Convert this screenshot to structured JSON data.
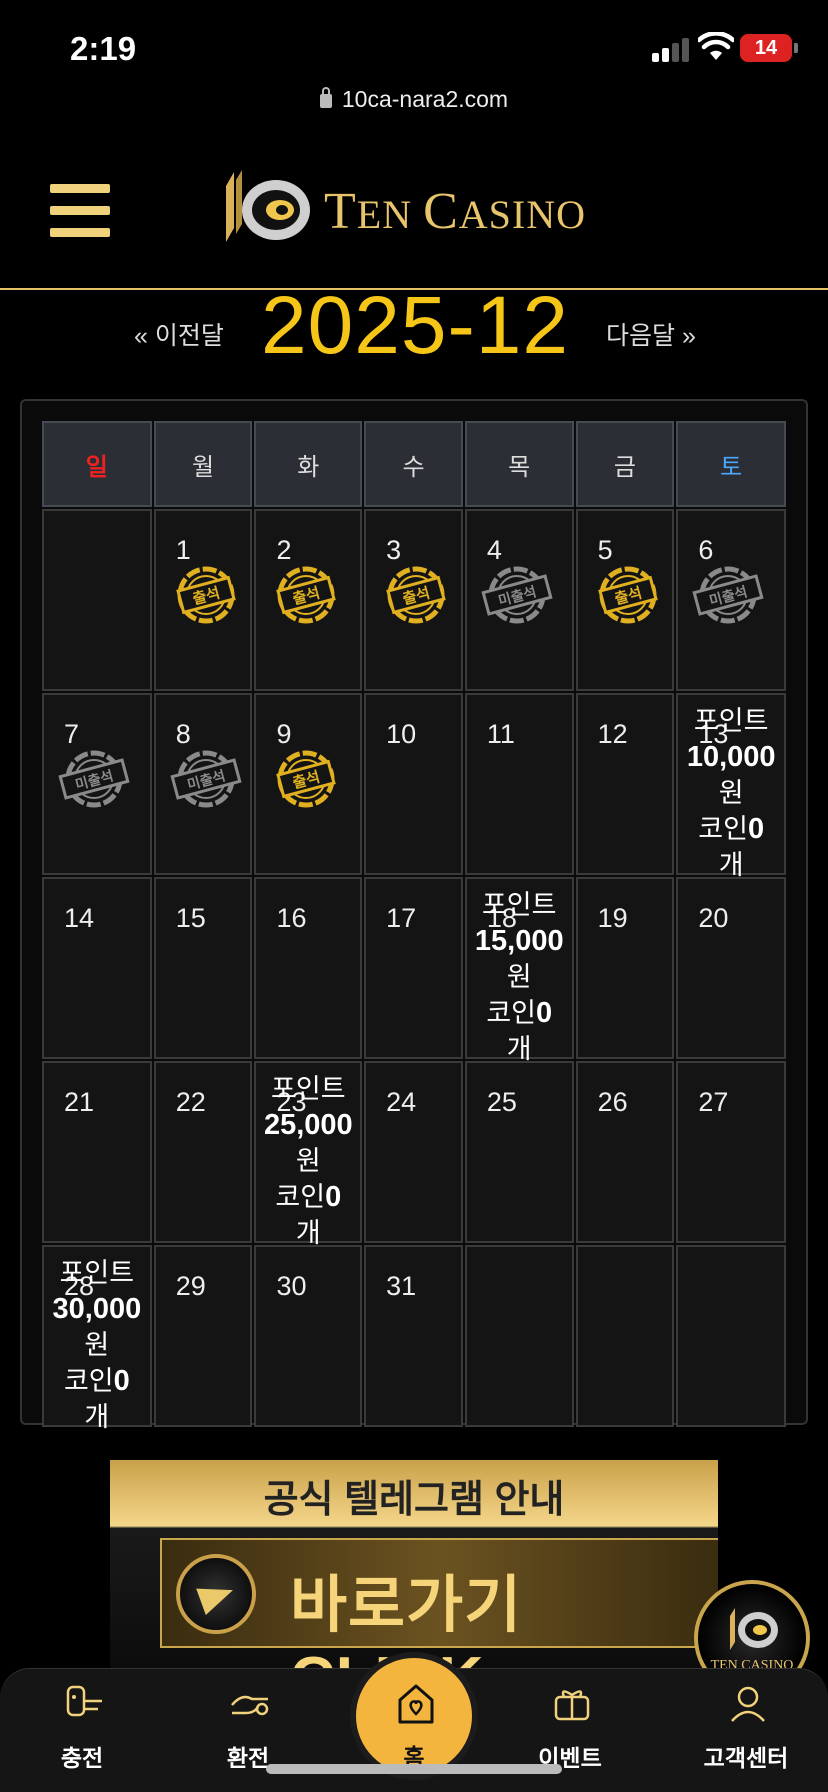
{
  "status": {
    "time": "2:19",
    "battery": "14"
  },
  "browser": {
    "url": "10ca-nara2.com"
  },
  "header": {
    "logo_text_big1": "T",
    "logo_text_small1": "EN ",
    "logo_text_big2": "C",
    "logo_text_small2": "ASINO"
  },
  "month_nav": {
    "prev": "« 이전달",
    "title": "2025-12",
    "next": "다음달 »"
  },
  "calendar": {
    "weekdays": [
      "일",
      "월",
      "화",
      "수",
      "목",
      "금",
      "토"
    ],
    "stamp_attend": "출석",
    "stamp_absent": "미출석",
    "stamp_colors": {
      "attend": "#e0b020",
      "absent": "#8a8a8a"
    },
    "weeks": [
      [
        {
          "day": ""
        },
        {
          "day": "1",
          "stamp": "attend"
        },
        {
          "day": "2",
          "stamp": "attend"
        },
        {
          "day": "3",
          "stamp": "attend"
        },
        {
          "day": "4",
          "stamp": "absent"
        },
        {
          "day": "5",
          "stamp": "attend"
        },
        {
          "day": "6",
          "stamp": "absent"
        }
      ],
      [
        {
          "day": "7",
          "stamp": "absent"
        },
        {
          "day": "8",
          "stamp": "absent"
        },
        {
          "day": "9",
          "stamp": "attend"
        },
        {
          "day": "10"
        },
        {
          "day": "11"
        },
        {
          "day": "12"
        },
        {
          "day": "13",
          "reward": {
            "l1": "포인트",
            "amount": "10,000",
            "unit": "원",
            "coin": "코인",
            "coin_val": "0",
            "coin_unit": "개"
          }
        }
      ],
      [
        {
          "day": "14"
        },
        {
          "day": "15"
        },
        {
          "day": "16"
        },
        {
          "day": "17"
        },
        {
          "day": "18",
          "reward": {
            "l1": "포인트",
            "amount": "15,000",
            "unit": "원",
            "coin": "코인",
            "coin_val": "0",
            "coin_unit": "개"
          }
        },
        {
          "day": "19"
        },
        {
          "day": "20"
        }
      ],
      [
        {
          "day": "21"
        },
        {
          "day": "22"
        },
        {
          "day": "23",
          "reward": {
            "l1": "포인트",
            "amount": "25,000",
            "unit": "원",
            "coin": "코인",
            "coin_val": "0",
            "coin_unit": "개"
          }
        },
        {
          "day": "24"
        },
        {
          "day": "25"
        },
        {
          "day": "26"
        },
        {
          "day": "27"
        }
      ],
      [
        {
          "day": "28",
          "reward": {
            "l1": "포인트",
            "amount": "30,000",
            "unit": "원",
            "coin": "코인",
            "coin_val": "0",
            "coin_unit": "개"
          }
        },
        {
          "day": "29"
        },
        {
          "day": "30"
        },
        {
          "day": "31"
        },
        {
          "day": ""
        },
        {
          "day": ""
        },
        {
          "day": ""
        }
      ]
    ]
  },
  "banner": {
    "title": "공식 텔레그램 안내",
    "cta": "바로가기 CLICK",
    "sub": ""
  },
  "float_logo": {
    "text": "TEN CASINO"
  },
  "bottom_nav": [
    {
      "label": "충전",
      "icon": "deposit-icon"
    },
    {
      "label": "환전",
      "icon": "withdraw-icon"
    },
    {
      "label": "홈",
      "icon": "home-icon"
    },
    {
      "label": "이벤트",
      "icon": "gift-icon"
    },
    {
      "label": "고객센터",
      "icon": "support-icon"
    }
  ]
}
